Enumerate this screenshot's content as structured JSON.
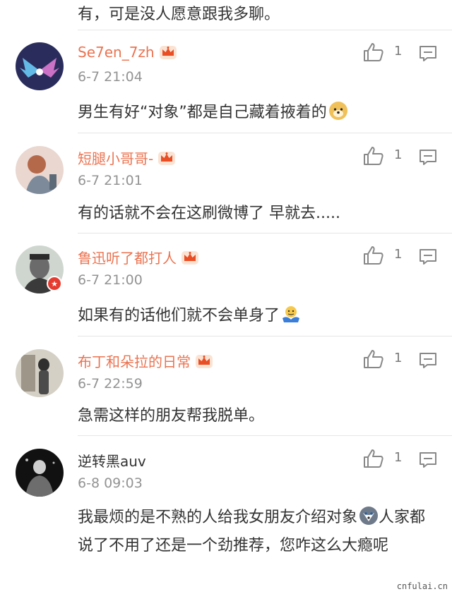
{
  "top_partial": {
    "text": "有，可是没人愿意跟我多聊。"
  },
  "comments": [
    {
      "username": "Se7en_7zh",
      "time": "6-7 21:04",
      "text": "男生有好“对象”都是自己藏着掖着的",
      "likes": "1",
      "emoji": "doge-emoji"
    },
    {
      "username": "短腿小哥哥-",
      "time": "6-7 21:01",
      "text": "有的话就不会在这刷微博了 早就去.....",
      "likes": "1"
    },
    {
      "username": "鲁迅听了都打人",
      "time": "6-7 21:00",
      "text": "如果有的话他们就不会单身了",
      "likes": "1",
      "emoji": "shrug-emoji"
    },
    {
      "username": "布丁和朵拉的日常",
      "time": "6-7 22:59",
      "text": "急需这样的朋友帮我脱单。",
      "likes": "1"
    },
    {
      "username": "逆转黑auv",
      "time": "6-8 09:03",
      "text_a": "我最烦的是不熟的人给我女朋友介绍对象",
      "text_b": "人家都说了不用了还是一个劲推荐，您咋这么大瘾呢",
      "likes": "1",
      "emoji": "husky-emoji"
    }
  ],
  "watermark": "cnfulai.cn",
  "colors": {
    "vip_name": "#eb7350",
    "normal_name": "#333333",
    "timestamp": "#939393"
  }
}
